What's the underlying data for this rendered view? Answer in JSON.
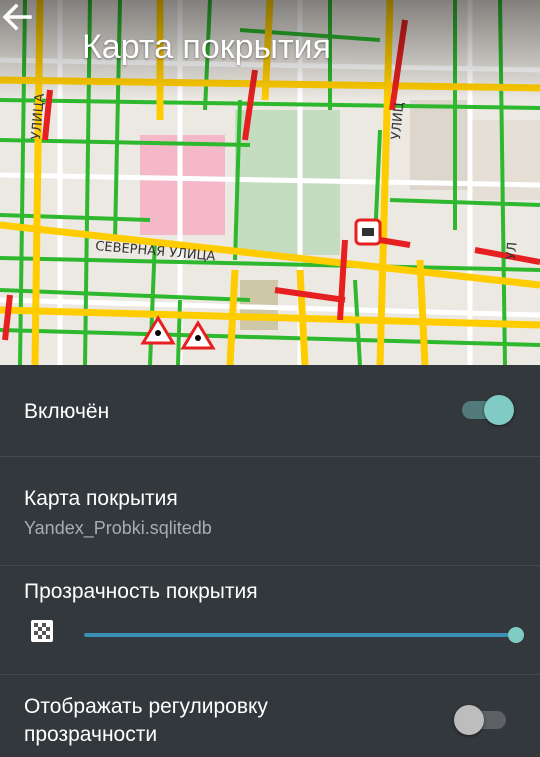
{
  "header": {
    "title": "Карта покрытия",
    "back_icon": "arrow-left-icon"
  },
  "map": {
    "street_label": "СЕВЕРНАЯ УЛИЦА",
    "side_label_1": "УЛИЦ",
    "side_label_2": "УЛИЦА",
    "side_label_3": "УЛ"
  },
  "settings": {
    "enabled": {
      "label": "Включён",
      "on": true
    },
    "overlay_map": {
      "label": "Карта покрытия",
      "value": "Yandex_Probki.sqlitedb"
    },
    "transparency": {
      "label": "Прозрачность покрытия",
      "icon": "checkerboard-icon",
      "level": 1.0
    },
    "show_transparency_control": {
      "label_line1": "Отображать регулировку",
      "label_line2": "прозрачности",
      "on": false
    }
  },
  "colors": {
    "background": "#33383d",
    "accent": "#80cbc4",
    "slider": "#3a8fb7",
    "traffic_green": "#2eb82e",
    "traffic_yellow": "#ffcc00",
    "traffic_red": "#e62020"
  }
}
